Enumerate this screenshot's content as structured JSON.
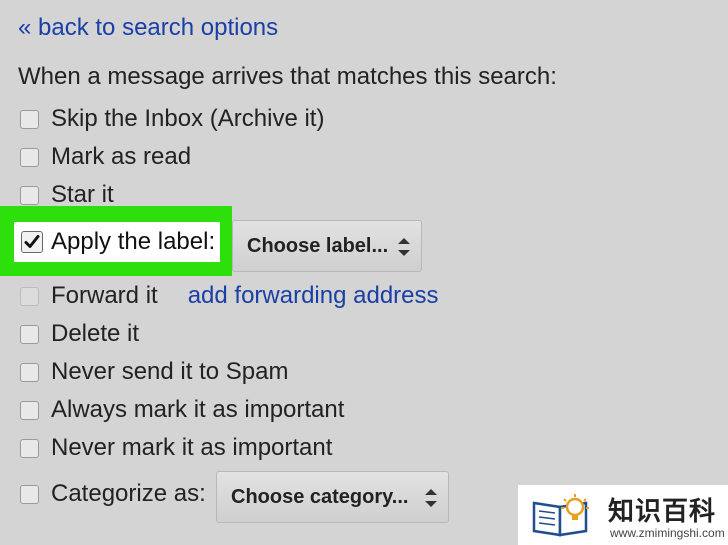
{
  "back_link": "« back to search options",
  "heading": "When a message arrives that matches this search:",
  "options": [
    {
      "label": "Skip the Inbox (Archive it)",
      "checked": false
    },
    {
      "label": "Mark as read",
      "checked": false
    },
    {
      "label": "Star it",
      "checked": false
    },
    {
      "label": "Apply the label:",
      "checked": true,
      "select": "Choose label..."
    },
    {
      "label": "Forward it",
      "checked": false,
      "disabled": true,
      "link": "add forwarding address"
    },
    {
      "label": "Delete it",
      "checked": false
    },
    {
      "label": "Never send it to Spam",
      "checked": false
    },
    {
      "label": "Always mark it as important",
      "checked": false
    },
    {
      "label": "Never mark it as important",
      "checked": false
    },
    {
      "label": "Categorize as:",
      "checked": false,
      "select": "Choose category..."
    }
  ],
  "watermark": {
    "title": "知识百科",
    "url": "www.zmimingshi.com"
  },
  "colors": {
    "background": "#d4d4d4",
    "link": "#1a3fa6",
    "highlight": "#2de00c"
  }
}
